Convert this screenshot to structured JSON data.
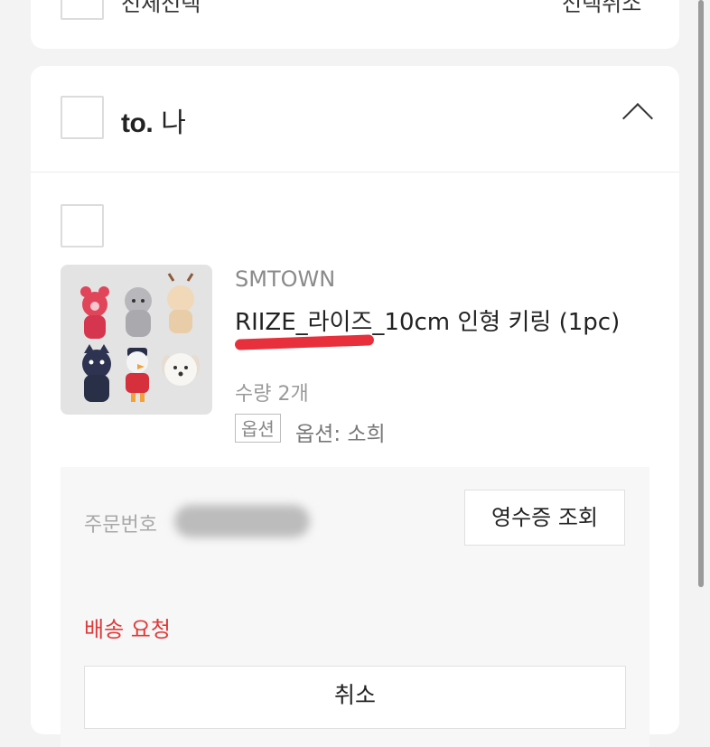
{
  "top_bar": {
    "select_all_label": "전체선택",
    "deselect_all_label": "선택취소"
  },
  "shop": {
    "logo_prefix": "to.",
    "logo_suffix": "나"
  },
  "product": {
    "brand": "SMTOWN",
    "title": "RIIZE_라이즈_10cm 인형 키링 (1pc)",
    "quantity": "수량 2개",
    "option_badge": "옵션",
    "option_value": "옵션: 소희"
  },
  "order": {
    "order_number_label": "주문번호",
    "receipt_button": "영수증 조회",
    "delivery_request": "배송 요청",
    "cancel_button": "취소"
  },
  "colors": {
    "accent_red": "#e03a3a",
    "background": "#f3f3f3"
  }
}
